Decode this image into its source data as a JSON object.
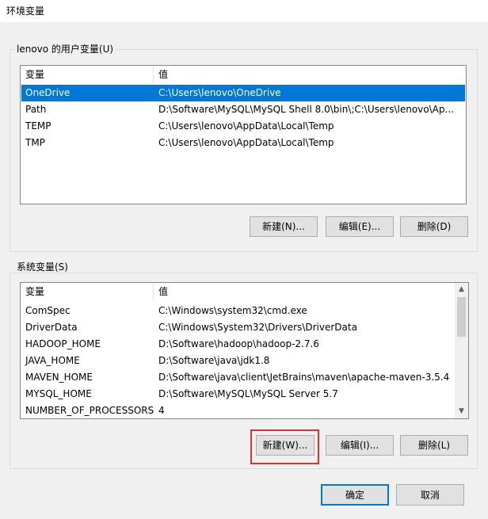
{
  "window": {
    "title": "环境变量"
  },
  "user_vars": {
    "group_label": "lenovo 的用户变量(U)",
    "columns": [
      "变量",
      "值"
    ],
    "rows": [
      {
        "name": "OneDrive",
        "value": "C:\\Users\\lenovo\\OneDrive"
      },
      {
        "name": "Path",
        "value": "D:\\Software\\MySQL\\MySQL Shell 8.0\\bin\\;C:\\Users\\lenovo\\Ap..."
      },
      {
        "name": "TEMP",
        "value": "C:\\Users\\lenovo\\AppData\\Local\\Temp"
      },
      {
        "name": "TMP",
        "value": "C:\\Users\\lenovo\\AppData\\Local\\Temp"
      }
    ],
    "selected_row": "OneDrive",
    "buttons": {
      "new": "新建(N)...",
      "edit": "编辑(E)...",
      "delete": "删除(D)"
    }
  },
  "system_vars": {
    "group_label": "系统变量(S)",
    "columns": [
      "变量",
      "值"
    ],
    "rows": [
      {
        "name": "ComSpec",
        "value": "C:\\Windows\\system32\\cmd.exe"
      },
      {
        "name": "DriverData",
        "value": "C:\\Windows\\System32\\Drivers\\DriverData"
      },
      {
        "name": "HADOOP_HOME",
        "value": "D:\\Software\\hadoop\\hadoop-2.7.6"
      },
      {
        "name": "JAVA_HOME",
        "value": "D:\\Software\\java\\jdk1.8"
      },
      {
        "name": "MAVEN_HOME",
        "value": "D:\\Software\\java\\client\\JetBrains\\maven\\apache-maven-3.5.4"
      },
      {
        "name": "MYSQL_HOME",
        "value": "D:\\Software\\MySQL\\MySQL Server 5.7"
      },
      {
        "name": "NUMBER_OF_PROCESSORS",
        "value": "4"
      }
    ],
    "buttons": {
      "new": "新建(W)...",
      "edit": "编辑(I)...",
      "delete": "删除(L)"
    }
  },
  "footer": {
    "ok": "确定",
    "cancel": "取消"
  },
  "colors": {
    "selection": "#0078d7",
    "highlight_box": "#e03030"
  }
}
